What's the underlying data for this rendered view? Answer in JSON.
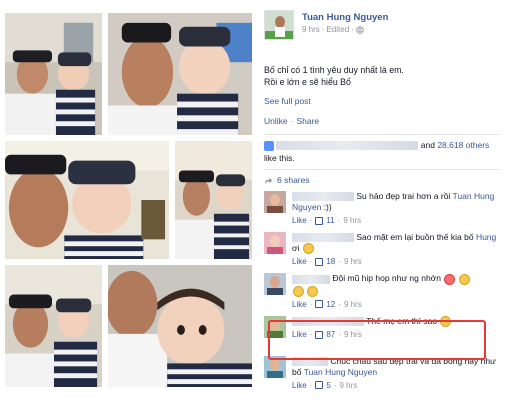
{
  "post": {
    "author_name": "Tuan Hung Nguyen",
    "timestamp": "9 hrs",
    "edited": "Edited",
    "privacy_icon": "globe-icon",
    "text_line1": "Bố chỉ có 1 tình yêu duy nhất là em.",
    "text_line2": "Rồi e lớn e sẽ hiểu Bố",
    "see_full": "See full post",
    "unlike": "Unlike",
    "share": "Share"
  },
  "feedback": {
    "and_text": "and",
    "others_link": "28,618 others",
    "like_this": "like this.",
    "shares": "6 shares"
  },
  "comments": [
    {
      "text": "Su hảo đẹp trai hơn a rồi",
      "mention": "Tuan Hung Nguyen",
      "suffix": ":))",
      "like": "Like",
      "likes": "11",
      "time": "9 hrs"
    },
    {
      "text": "Sao mặt em lại buồn thế kia bố",
      "mention": "Hung",
      "suffix": "ơi",
      "like": "Like",
      "likes": "18",
      "time": "9 hrs"
    },
    {
      "text": "Đội mũ hip hop như ng nhớn",
      "like": "Like",
      "likes": "12",
      "time": "9 hrs"
    },
    {
      "text": "Thế mẹ em thì sao",
      "like": "Like",
      "likes": "87",
      "time": "9 hrs"
    },
    {
      "text": "Chúc cháu sau đẹp trai và đá bóng hay như bố",
      "mention": "Tuan Hung Nguyen",
      "like": "Like",
      "likes": "5",
      "time": "9 hrs"
    }
  ],
  "colors": {
    "link": "#3b5998",
    "highlight": "#e53935",
    "meta": "#90949c"
  }
}
